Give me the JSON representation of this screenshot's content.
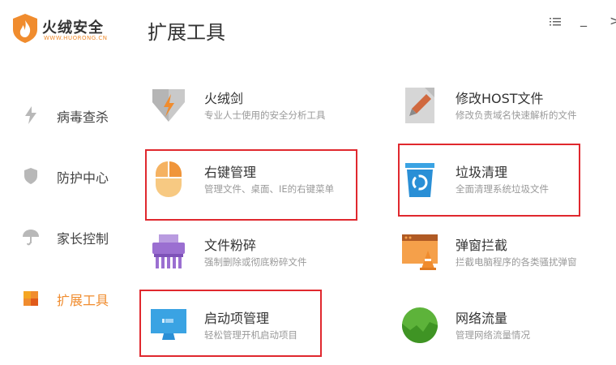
{
  "app": {
    "name": "火绒安全",
    "url": "WWW.HUORONG.CN"
  },
  "page_title": "扩展工具",
  "window_controls": {
    "menu_icon": "menu-icon",
    "minimize": "_",
    "close": ">"
  },
  "sidebar": {
    "items": [
      {
        "label": "病毒查杀",
        "icon": "lightning-icon",
        "active": false
      },
      {
        "label": "防护中心",
        "icon": "shield-icon",
        "active": false
      },
      {
        "label": "家长控制",
        "icon": "umbrella-icon",
        "active": false
      },
      {
        "label": "扩展工具",
        "icon": "grid-icon",
        "active": true
      }
    ]
  },
  "tools": [
    {
      "name": "火绒剑",
      "desc": "专业人士使用的安全分析工具",
      "icon": "sword-icon"
    },
    {
      "name": "修改HOST文件",
      "desc": "修改负责域名快速解析的文件",
      "icon": "edit-file-icon"
    },
    {
      "name": "右键管理",
      "desc": "管理文件、桌面、IE的右键菜单",
      "icon": "mouse-icon",
      "highlighted": true
    },
    {
      "name": "垃圾清理",
      "desc": "全面清理系统垃圾文件",
      "icon": "trash-icon",
      "highlighted": true
    },
    {
      "name": "文件粉碎",
      "desc": "强制删除或彻底粉碎文件",
      "icon": "shredder-icon"
    },
    {
      "name": "弹窗拦截",
      "desc": "拦截电脑程序的各类骚扰弹窗",
      "icon": "popup-block-icon"
    },
    {
      "name": "启动项管理",
      "desc": "轻松管理开机启动项目",
      "icon": "monitor-icon",
      "highlighted": true
    },
    {
      "name": "网络流量",
      "desc": "管理网络流量情况",
      "icon": "network-globe-icon"
    }
  ],
  "colors": {
    "accent": "#f08c2e",
    "highlight_box": "#e0282e"
  }
}
